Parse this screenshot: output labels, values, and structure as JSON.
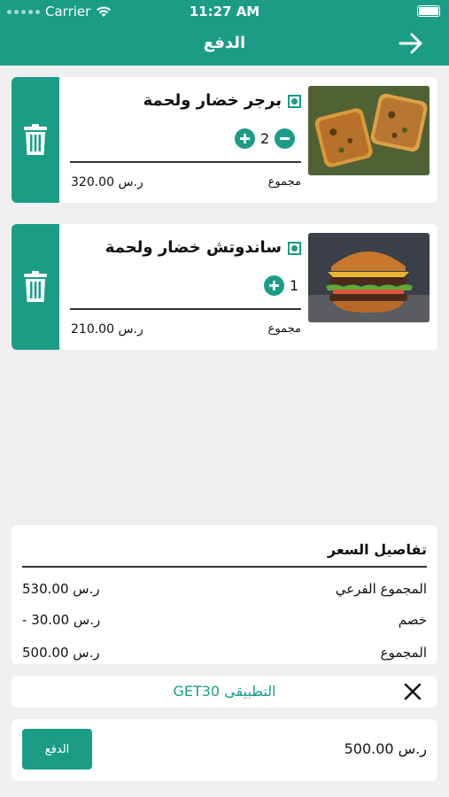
{
  "status_bar": {
    "carrier": "Carrier",
    "time": "11:27 AM"
  },
  "header": {
    "title": "الدفع"
  },
  "colors": {
    "accent": "#1a9c87"
  },
  "cart_items": [
    {
      "name": "برجر خضار ولحمة",
      "quantity": "2",
      "total_label": "مجموع",
      "price": "ر.س 320.00",
      "image_icon": "toast-photo"
    },
    {
      "name": "ساندوتش خضار ولحمة",
      "quantity": "1",
      "total_label": "مجموع",
      "price": "ر.س 210.00",
      "image_icon": "burger-photo"
    }
  ],
  "price_details": {
    "title": "تفاصيل السعر",
    "rows": [
      {
        "label": "المجموع الفرعي",
        "value": "ر.س 530.00"
      },
      {
        "label": "خصم",
        "value": "- ر.س 30.00"
      },
      {
        "label": "المجموع",
        "value": "ر.س 500.00"
      }
    ]
  },
  "coupon": {
    "text": "التطبيقى GET30"
  },
  "footer": {
    "total": "ر.س 500.00",
    "pay_label": "الدفع"
  }
}
